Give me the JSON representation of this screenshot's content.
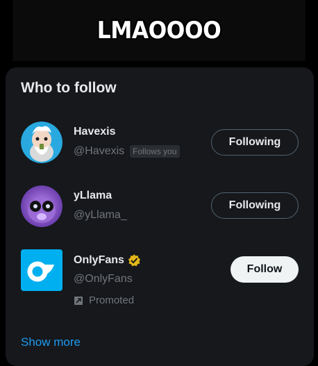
{
  "caption": "LMAOOOO",
  "panel": {
    "title": "Who to follow",
    "show_more": "Show more"
  },
  "accounts": [
    {
      "name": "Havexis",
      "handle": "@Havexis",
      "follows_you": "Follows you",
      "button": "Following",
      "avatar_icon": "cartoon-guy-avatar"
    },
    {
      "name": "yLlama",
      "handle": "@yLlama_",
      "button": "Following",
      "avatar_icon": "llama-avatar"
    },
    {
      "name": "OnlyFans",
      "handle": "@OnlyFans",
      "verified_icon": "verified-badge-icon",
      "promoted": "Promoted",
      "button": "Follow",
      "avatar_icon": "onlyfans-logo"
    }
  ],
  "colors": {
    "accent": "#1d9bf0",
    "panel_bg": "#16181c",
    "verified_gold": "#e2b719"
  }
}
